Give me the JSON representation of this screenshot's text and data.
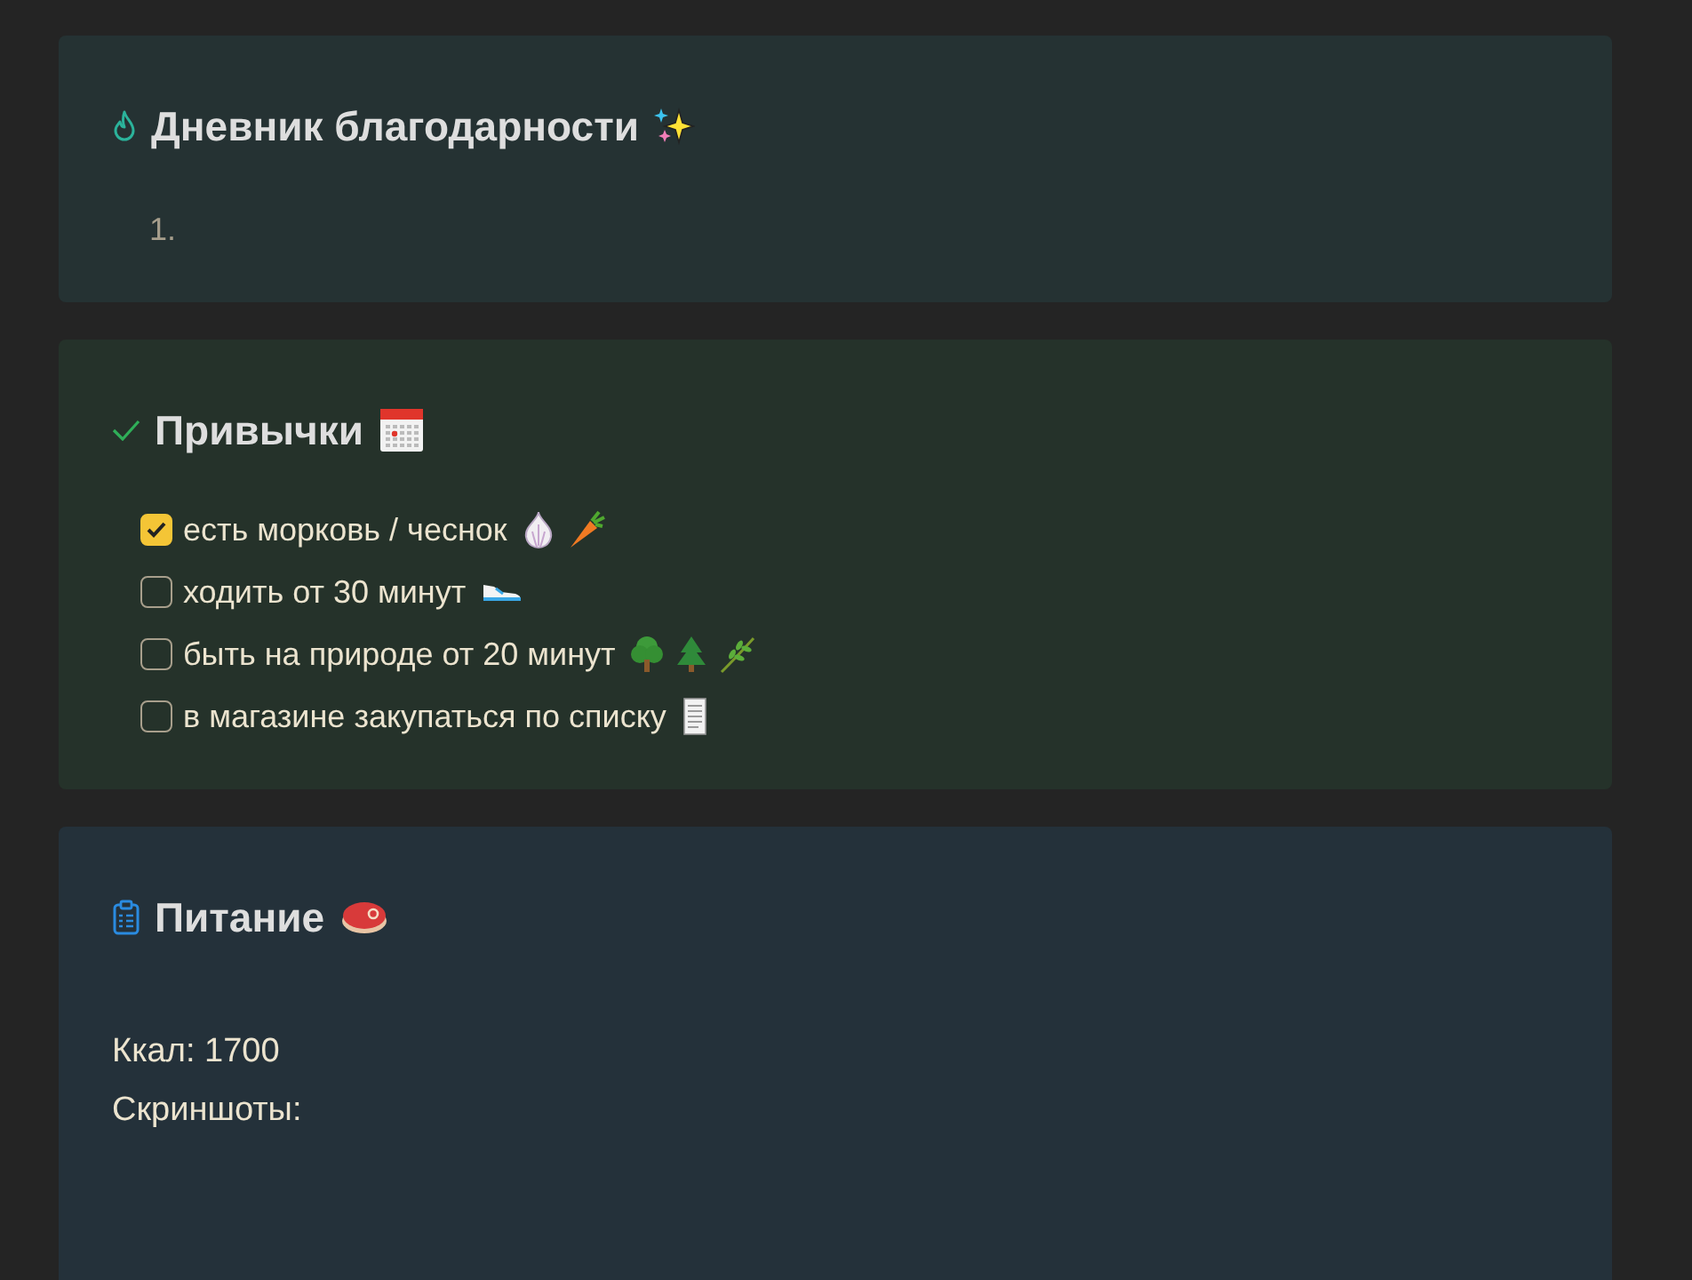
{
  "cards": [
    {
      "kind": "gratitude",
      "title": "Дневник благодарности",
      "ordered_list": [
        {
          "number": "1."
        }
      ]
    },
    {
      "kind": "habits",
      "title": "Привычки",
      "tasks": [
        {
          "label": "есть морковь / чеснок",
          "checked": true
        },
        {
          "label": "ходить от 30 минут",
          "checked": false
        },
        {
          "label": "быть на природе от 20 минут",
          "checked": false
        },
        {
          "label": "в магазине закупаться по списку",
          "checked": false
        }
      ]
    },
    {
      "kind": "nutrition",
      "title": "Питание",
      "lines": [
        "Ккал: 1700",
        "Скриншоты:"
      ]
    }
  ]
}
